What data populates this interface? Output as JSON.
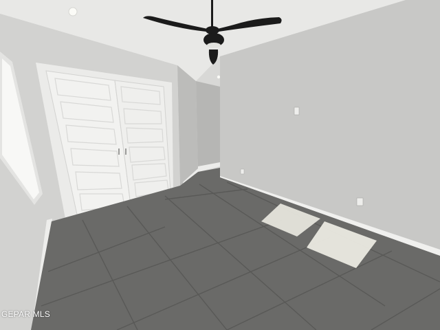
{
  "watermark": {
    "text": "GEPAR MLS"
  },
  "colors": {
    "ceiling": "#e9e9e7",
    "wall_right": "#c9c9c7",
    "wall_left": "#d0d0ce",
    "wall_back": "#bdbdbb",
    "floor": "#6b6b69",
    "floor_grout": "#5a5a58",
    "door": "#f1f1ef",
    "trim": "#f4f4f2",
    "fan": "#1c1c1c",
    "sunlight": "#ecebe4"
  }
}
